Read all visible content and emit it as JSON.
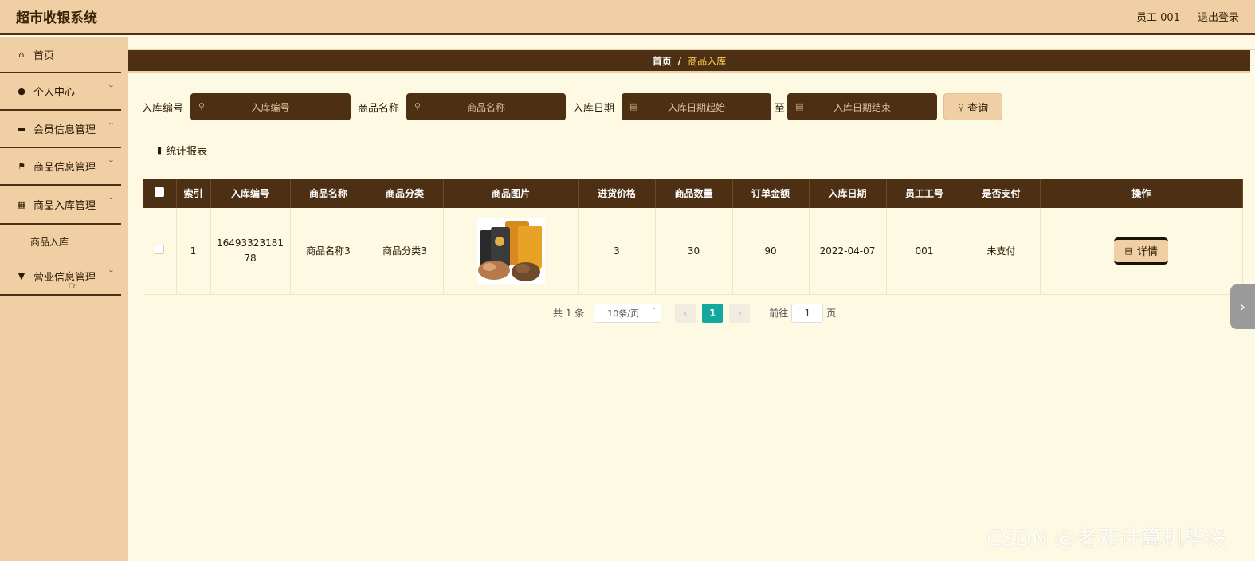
{
  "header": {
    "app_title": "超市收银系统",
    "user": "员工 001",
    "logout": "退出登录"
  },
  "sidebar": {
    "items": [
      {
        "label": "首页",
        "icon": "home-icon"
      },
      {
        "label": "个人中心",
        "icon": "user-icon"
      },
      {
        "label": "会员信息管理",
        "icon": "ticket-icon"
      },
      {
        "label": "商品信息管理",
        "icon": "flag-icon"
      },
      {
        "label": "商品入库管理",
        "icon": "grid-icon",
        "sub": [
          "商品入库"
        ]
      },
      {
        "label": "营业信息管理",
        "icon": "sign-icon"
      }
    ]
  },
  "breadcrumb": {
    "home": "首页",
    "sep": "/",
    "current": "商品入库"
  },
  "search": {
    "label_no": "入库编号",
    "placeholder_no": "入库编号",
    "label_name": "商品名称",
    "placeholder_name": "商品名称",
    "label_date": "入库日期",
    "placeholder_start": "入库日期起始",
    "to": "至",
    "placeholder_end": "入库日期结束",
    "query": "查询"
  },
  "stat_report": "统计报表",
  "table": {
    "headers": [
      "索引",
      "入库编号",
      "商品名称",
      "商品分类",
      "商品图片",
      "进货价格",
      "商品数量",
      "订单金额",
      "入库日期",
      "员工工号",
      "是否支付",
      "操作"
    ],
    "rows": [
      {
        "index": "1",
        "no": "164933231817 8",
        "no_line1": "16493323181",
        "no_line2": "78",
        "name": "商品名称3",
        "category": "商品分类3",
        "price": "3",
        "qty": "30",
        "amount": "90",
        "date": "2022-04-07",
        "staff": "001",
        "paid": "未支付",
        "action": "详情"
      }
    ]
  },
  "pagination": {
    "total": "共 1 条",
    "page_size": "10条/页",
    "current": "1",
    "goto": "前往",
    "goto_value": "1",
    "page_unit": "页"
  },
  "watermark": "CSDN @老邓计算机毕设",
  "colors": {
    "accent": "#4d3013",
    "sidebar": "#efcfa3",
    "background": "#fdf9e2",
    "page_active": "#13a89e"
  }
}
